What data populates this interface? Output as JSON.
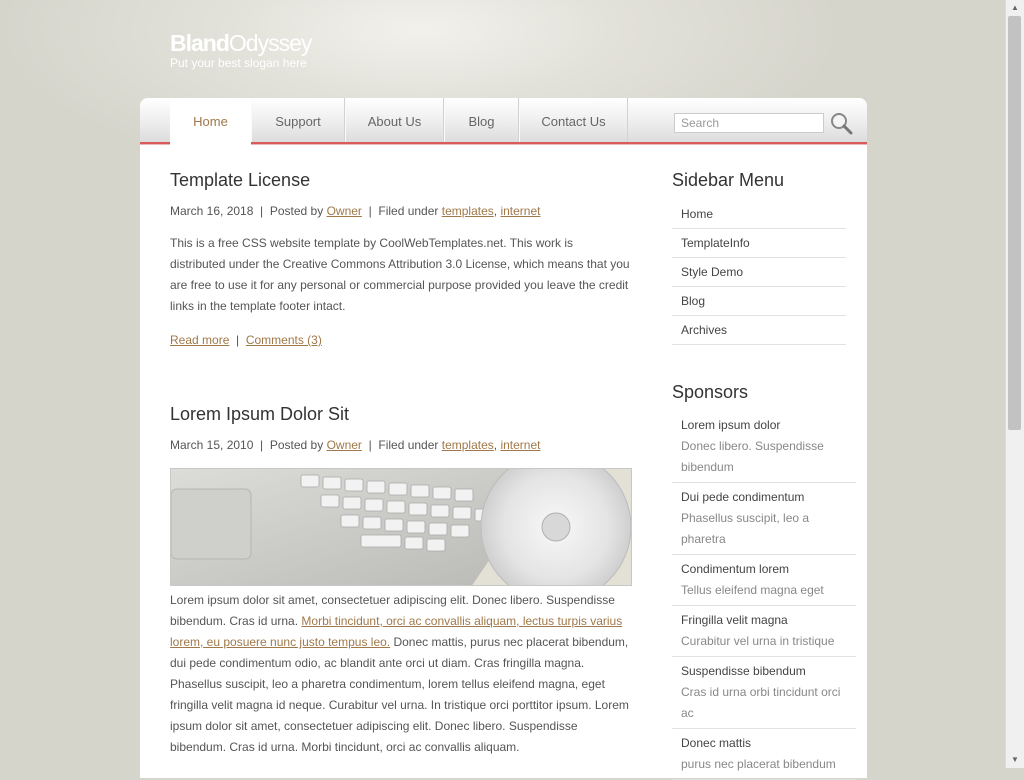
{
  "site": {
    "logo_bold": "Bland",
    "logo_rest": "Odyssey",
    "slogan": "Put your best slogan here"
  },
  "nav": {
    "items": [
      {
        "label": "Home",
        "active": true
      },
      {
        "label": "Support"
      },
      {
        "label": "About Us"
      },
      {
        "label": "Blog"
      },
      {
        "label": "Contact Us"
      }
    ],
    "search_placeholder": "Search"
  },
  "posts": [
    {
      "title": "Template License",
      "date": "March 16, 2018",
      "posted_by": "Posted by",
      "author": "Owner",
      "filed_under": "Filed under",
      "tags": [
        "templates",
        "internet"
      ],
      "body": "This is a free CSS website template by CoolWebTemplates.net. This work is distributed under the Creative Commons Attribution 3.0 License, which means that you are free to use it for any personal or commercial purpose provided you leave the credit links in the template footer intact.",
      "read_more": "Read more",
      "comments": "Comments (3)"
    },
    {
      "title": "Lorem Ipsum Dolor Sit",
      "date": "March 15, 2010",
      "posted_by": "Posted by",
      "author": "Owner",
      "filed_under": "Filed under",
      "tags": [
        "templates",
        "internet"
      ],
      "body_start": "Lorem ipsum dolor sit amet, consectetuer adipiscing elit. Donec libero. Suspendisse bibendum. Cras id urna. ",
      "body_link": "Morbi tincidunt, orci ac convallis aliquam, lectus turpis varius lorem, eu posuere nunc justo tempus leo.",
      "body_end": " Donec mattis, purus nec placerat bibendum, dui pede condimentum odio, ac blandit ante orci ut diam. Cras fringilla magna. Phasellus suscipit, leo a pharetra condimentum, lorem tellus eleifend magna, eget fringilla velit magna id neque. Curabitur vel urna. In tristique orci porttitor ipsum. Lorem ipsum dolor sit amet, consectetuer adipiscing elit. Donec libero. Suspendisse bibendum. Cras id urna. Morbi tincidunt, orci ac convallis aliquam."
    }
  ],
  "sidebar": {
    "menu_title": "Sidebar Menu",
    "menu": [
      "Home",
      "TemplateInfo",
      "Style Demo",
      "Blog",
      "Archives"
    ],
    "sponsors_title": "Sponsors",
    "sponsors": [
      {
        "title": "Lorem ipsum dolor",
        "desc": "Donec libero. Suspendisse bibendum"
      },
      {
        "title": "Dui pede condimentum",
        "desc": "Phasellus suscipit, leo a pharetra"
      },
      {
        "title": "Condimentum lorem",
        "desc": "Tellus eleifend magna eget"
      },
      {
        "title": "Fringilla velit magna",
        "desc": "Curabitur vel urna in tristique"
      },
      {
        "title": "Suspendisse bibendum",
        "desc": "Cras id urna orbi tincidunt orci ac"
      },
      {
        "title": "Donec mattis",
        "desc": "purus nec placerat bibendum"
      }
    ]
  },
  "colors": {
    "accent": "#a0784a",
    "nav_border": "#d95a5a",
    "background": "#d6d5cc"
  }
}
